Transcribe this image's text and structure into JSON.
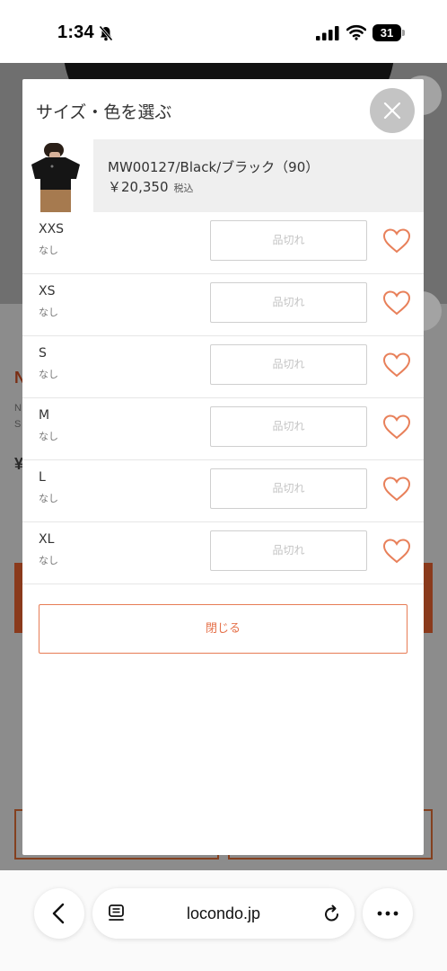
{
  "status_bar": {
    "time": "1:34",
    "battery": "31",
    "icons": [
      "bell-slash-icon",
      "cellular-signal-icon",
      "wifi-icon",
      "battery-icon"
    ]
  },
  "modal": {
    "title": "サイズ・色を選ぶ",
    "close_icon": "close-icon",
    "product": {
      "name": "MW00127/Black/ブラック（90）",
      "price": "￥20,350",
      "tax_label": "税込"
    },
    "sizes": [
      {
        "size": "XXS",
        "stock": "なし",
        "button": "品切れ"
      },
      {
        "size": "XS",
        "stock": "なし",
        "button": "品切れ"
      },
      {
        "size": "S",
        "stock": "なし",
        "button": "品切れ"
      },
      {
        "size": "M",
        "stock": "なし",
        "button": "品切れ"
      },
      {
        "size": "L",
        "stock": "なし",
        "button": "品切れ"
      },
      {
        "size": "XL",
        "stock": "なし",
        "button": "品切れ"
      }
    ],
    "close_button_label": "閉じる"
  },
  "browser": {
    "url": "locondo.jp",
    "icons": [
      "chevron-left-icon",
      "reader-icon",
      "reload-icon",
      "more-icon"
    ]
  },
  "colors": {
    "accent": "#e77c55",
    "heart": "#e8805a",
    "soldout_text": "#c4c4c4",
    "overlay": "#8c8c8c"
  }
}
